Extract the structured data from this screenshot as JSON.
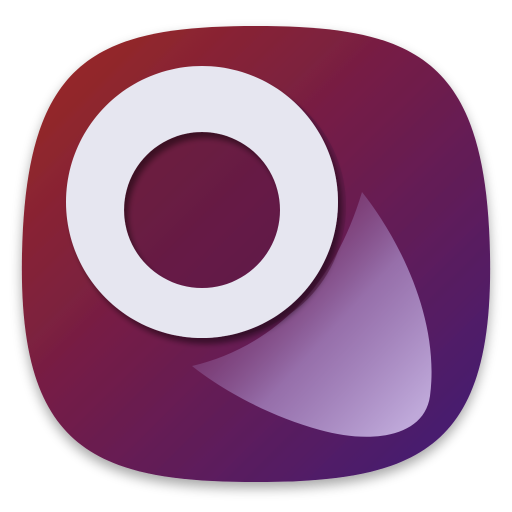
{
  "icon": {
    "name": "app-launcher-icon",
    "shape": "squircle",
    "colors": {
      "gradient_start": "#9e2a1f",
      "gradient_mid": "#6e1c4c",
      "gradient_end": "#3e1a78",
      "ring": "#e6e6f0",
      "shadow": "#5a1a45",
      "swoosh_light": "#b9a3d6",
      "swoosh_dark": "#7a3a78"
    }
  }
}
